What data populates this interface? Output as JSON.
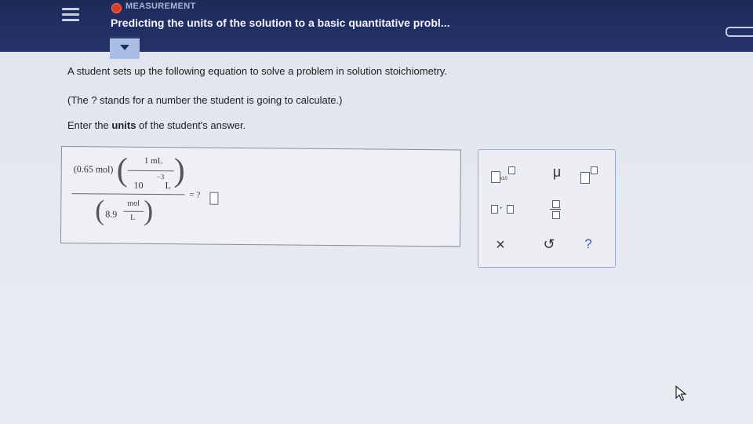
{
  "header": {
    "topic": "MEASUREMENT",
    "title": "Predicting the units of the solution to a basic quantitative probl..."
  },
  "question": {
    "line1": "A student sets up the following equation to solve a problem in solution stoichiometry.",
    "line2": "(The ? stands for a number the student is going to calculate.)",
    "line3_prefix": "Enter the ",
    "line3_bold": "units",
    "line3_suffix": " of the student's answer."
  },
  "equation": {
    "num_value": "(0.65 mol)",
    "conv_top": "1 mL",
    "conv_base": "10",
    "conv_exp": "−3",
    "conv_unit": "L",
    "den_value": "8.9",
    "den_top": "mol",
    "den_bottom": "L",
    "equals": "= ?"
  },
  "palette": {
    "x10_label": "x10",
    "mu": "μ",
    "dot": "·",
    "clear": "×",
    "undo": "↺",
    "help": "?"
  }
}
